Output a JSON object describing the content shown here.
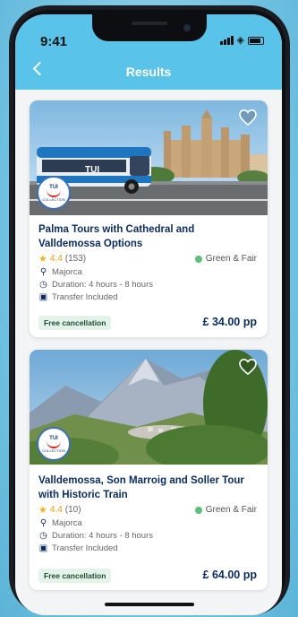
{
  "status_bar": {
    "time": "9:41"
  },
  "header": {
    "title": "Results",
    "back_icon": "chevron-left-icon"
  },
  "colors": {
    "header": "#5ac3ea",
    "price": "#0a2b5e",
    "star": "#f2b21b",
    "eco": "#5cbf77",
    "cancel_bg": "#e4f3ea"
  },
  "results": [
    {
      "title": "Palma Tours with Cathedral and Valldemossa Options",
      "rating": "4.4",
      "reviews": "(153)",
      "green_label": "Green & Fair",
      "location": "Majorca",
      "duration": "Duration: 4 hours - 8 hours",
      "transfer": "Transfer Included",
      "cancellation": "Free cancellation",
      "price": "£ 34.00 pp",
      "bus_brand": "TUI"
    },
    {
      "title": "Valldemossa, Son Marroig and Soller Tour with Historic Train",
      "rating": "4.4",
      "reviews": "(10)",
      "green_label": "Green & Fair",
      "location": "Majorca",
      "duration": "Duration: 4 hours - 8 hours",
      "transfer": "Transfer Included",
      "cancellation": "Free cancellation",
      "price": "£ 64.00 pp"
    }
  ],
  "badge": {
    "brand": "TUI",
    "collection": "COLLECTION"
  }
}
